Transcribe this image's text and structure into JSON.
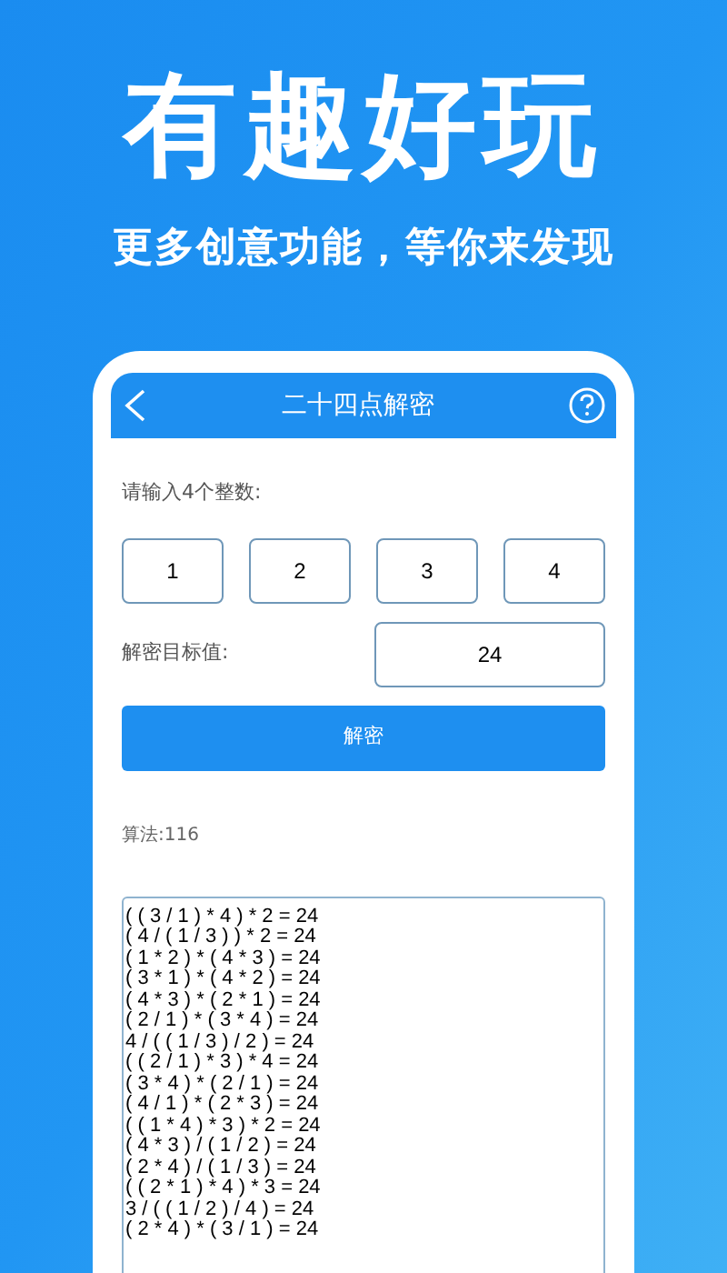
{
  "headline": "有趣好玩",
  "subtitle": "更多创意功能，等你来发现",
  "app": {
    "title": "二十四点解密",
    "prompt": "请输入4个整数:",
    "numbers": [
      "1",
      "2",
      "3",
      "4"
    ],
    "target_label": "解密目标值:",
    "target": "24",
    "button": "解密",
    "count": "算法:116",
    "results": [
      "( ( 3 / 1 ) * 4 ) * 2 = 24",
      "( 4 / ( 1 / 3 ) ) * 2 = 24",
      "( 1 * 2 ) * ( 4 * 3 ) = 24",
      "( 3 * 1 ) * ( 4 * 2 ) = 24",
      "( 4 * 3 ) * ( 2 * 1 ) = 24",
      "( 2 / 1 ) * ( 3 * 4 ) = 24",
      "4 / ( ( 1 / 3 ) / 2 ) = 24",
      "( ( 2 / 1 ) * 3 ) * 4 = 24",
      "( 3 * 4 ) * ( 2 / 1 ) = 24",
      "( 4 / 1 ) * ( 2 * 3 ) = 24",
      "( ( 1 * 4 ) * 3 ) * 2 = 24",
      "( 4 * 3 ) / ( 1 / 2 ) = 24",
      "( 2 * 4 ) / ( 1 / 3 ) = 24",
      "( ( 2 * 1 ) * 4 ) * 3 = 24",
      "3 / ( ( 1 / 2 ) / 4 ) = 24",
      "( 2 * 4 ) * ( 3 / 1 ) = 24"
    ]
  }
}
